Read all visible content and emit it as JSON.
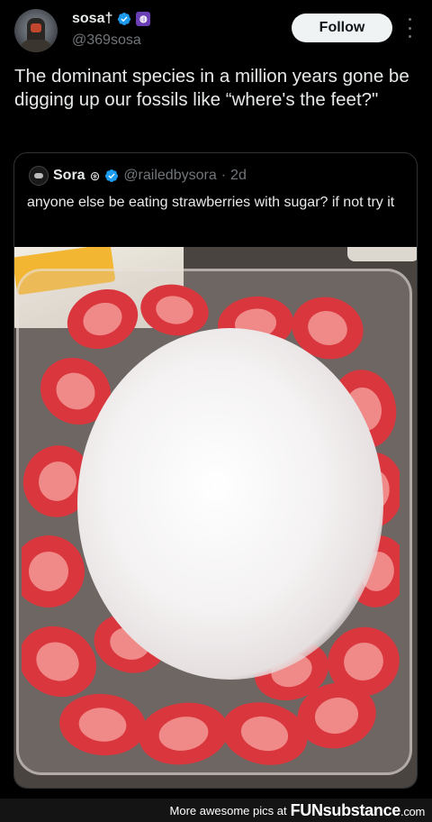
{
  "author": {
    "display_name": "sosa†",
    "handle": "@369sosa",
    "badge_sub_glyph": "◍"
  },
  "follow_label": "Follow",
  "tweet_text": "The dominant species in a million years gone be digging up our fossils like “where's the feet?\"",
  "quoted": {
    "display_name": "Sora",
    "emoji": "⊛",
    "handle": "@railedbysora",
    "separator": "·",
    "time": "2d",
    "text": "anyone else be eating strawberries with sugar? if not try it"
  },
  "watermark": {
    "text": "More awesome pics at",
    "brand_main": "FUNsubstance",
    "brand_tld": ".com"
  },
  "colors": {
    "background": "#000000",
    "verified": "#1d9bf0",
    "muted": "#71767b",
    "strawberry": "#d9363e",
    "sugar": "#f6f4f4"
  }
}
